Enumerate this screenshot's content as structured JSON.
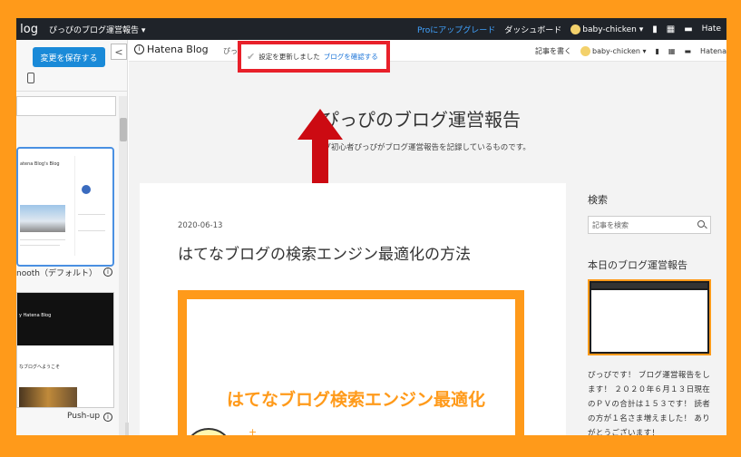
{
  "topbar": {
    "logo": "log",
    "blog_title": "ぴっぴのブログ運営報告 ▾",
    "upgrade": "Proにアップグレード",
    "dashboard": "ダッシュボード",
    "user": "baby-chicken ▾",
    "hatena": "Hate"
  },
  "sidebar": {
    "save_label": "変更を保存する",
    "collapse_label": "<",
    "themes": [
      {
        "preview_title": "atena Blog's Blog",
        "label": "nooth（デフォルト）"
      },
      {
        "preview_title": "y Hatena Blog",
        "welcome": "なブログへようこそ",
        "label": "Push-up"
      }
    ]
  },
  "blog_header": {
    "logo": "Hatena Blog",
    "pp": "ぴっ",
    "write": "記事を書く",
    "user": "baby-chicken ▾",
    "hatena": "Hatena"
  },
  "notice": {
    "check": "✔",
    "text": "設定を更新しました",
    "link": "ブログを確認する"
  },
  "blog": {
    "title": "ぴっぴのブログ運営報告",
    "description": "ログ初心者ぴっぴがブログ運営報告を記録しているものです。"
  },
  "post": {
    "date": "2020-06-13",
    "title": "はてなブログの検索エンジン最適化の方法",
    "eyecatch_text": "はてなブログ検索エンジン最適化",
    "sparkle": "+"
  },
  "blog_sidebar": {
    "search_heading": "検索",
    "search_placeholder": "記事を検索",
    "recent_heading": "本日のブログ運営報告",
    "recent_text": "ぴっぴです！ ブログ運営報告をします！ ２０２０年６月１３日現在のＰＶの合計は１５３です！ 読者の方が１名さま増えました！ ありがとうございます！"
  },
  "colors": {
    "accent_orange": "#ff9a1a",
    "notice_border": "#e8202a",
    "arrow_red": "#cc0a12",
    "save_button": "#1a8ad8"
  }
}
